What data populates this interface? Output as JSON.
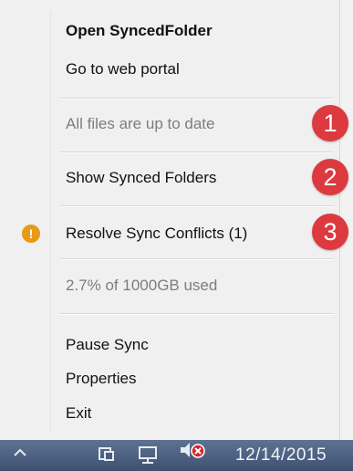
{
  "menu": {
    "items": [
      {
        "label": "Open SyncedFolder"
      },
      {
        "label": "Go to web portal"
      },
      {
        "label": "All files are up to date"
      },
      {
        "label": "Show Synced Folders"
      },
      {
        "label": "Resolve Sync Conflicts (1)"
      },
      {
        "label": "2.7% of 1000GB used"
      },
      {
        "label": "Pause Sync"
      },
      {
        "label": "Properties"
      },
      {
        "label": "Exit"
      }
    ],
    "warning_glyph": "!",
    "warning_icon": "warning-icon"
  },
  "callouts": [
    "1",
    "2",
    "3"
  ],
  "taskbar": {
    "clock": "12/14/2015",
    "icons": [
      "tray-up-arrow-icon",
      "action-center-icon",
      "network-icon",
      "volume-muted-icon"
    ]
  },
  "colors": {
    "badge": "#dc3a3f",
    "warning": "#e79a16",
    "taskbar": "#4a5d7c"
  }
}
